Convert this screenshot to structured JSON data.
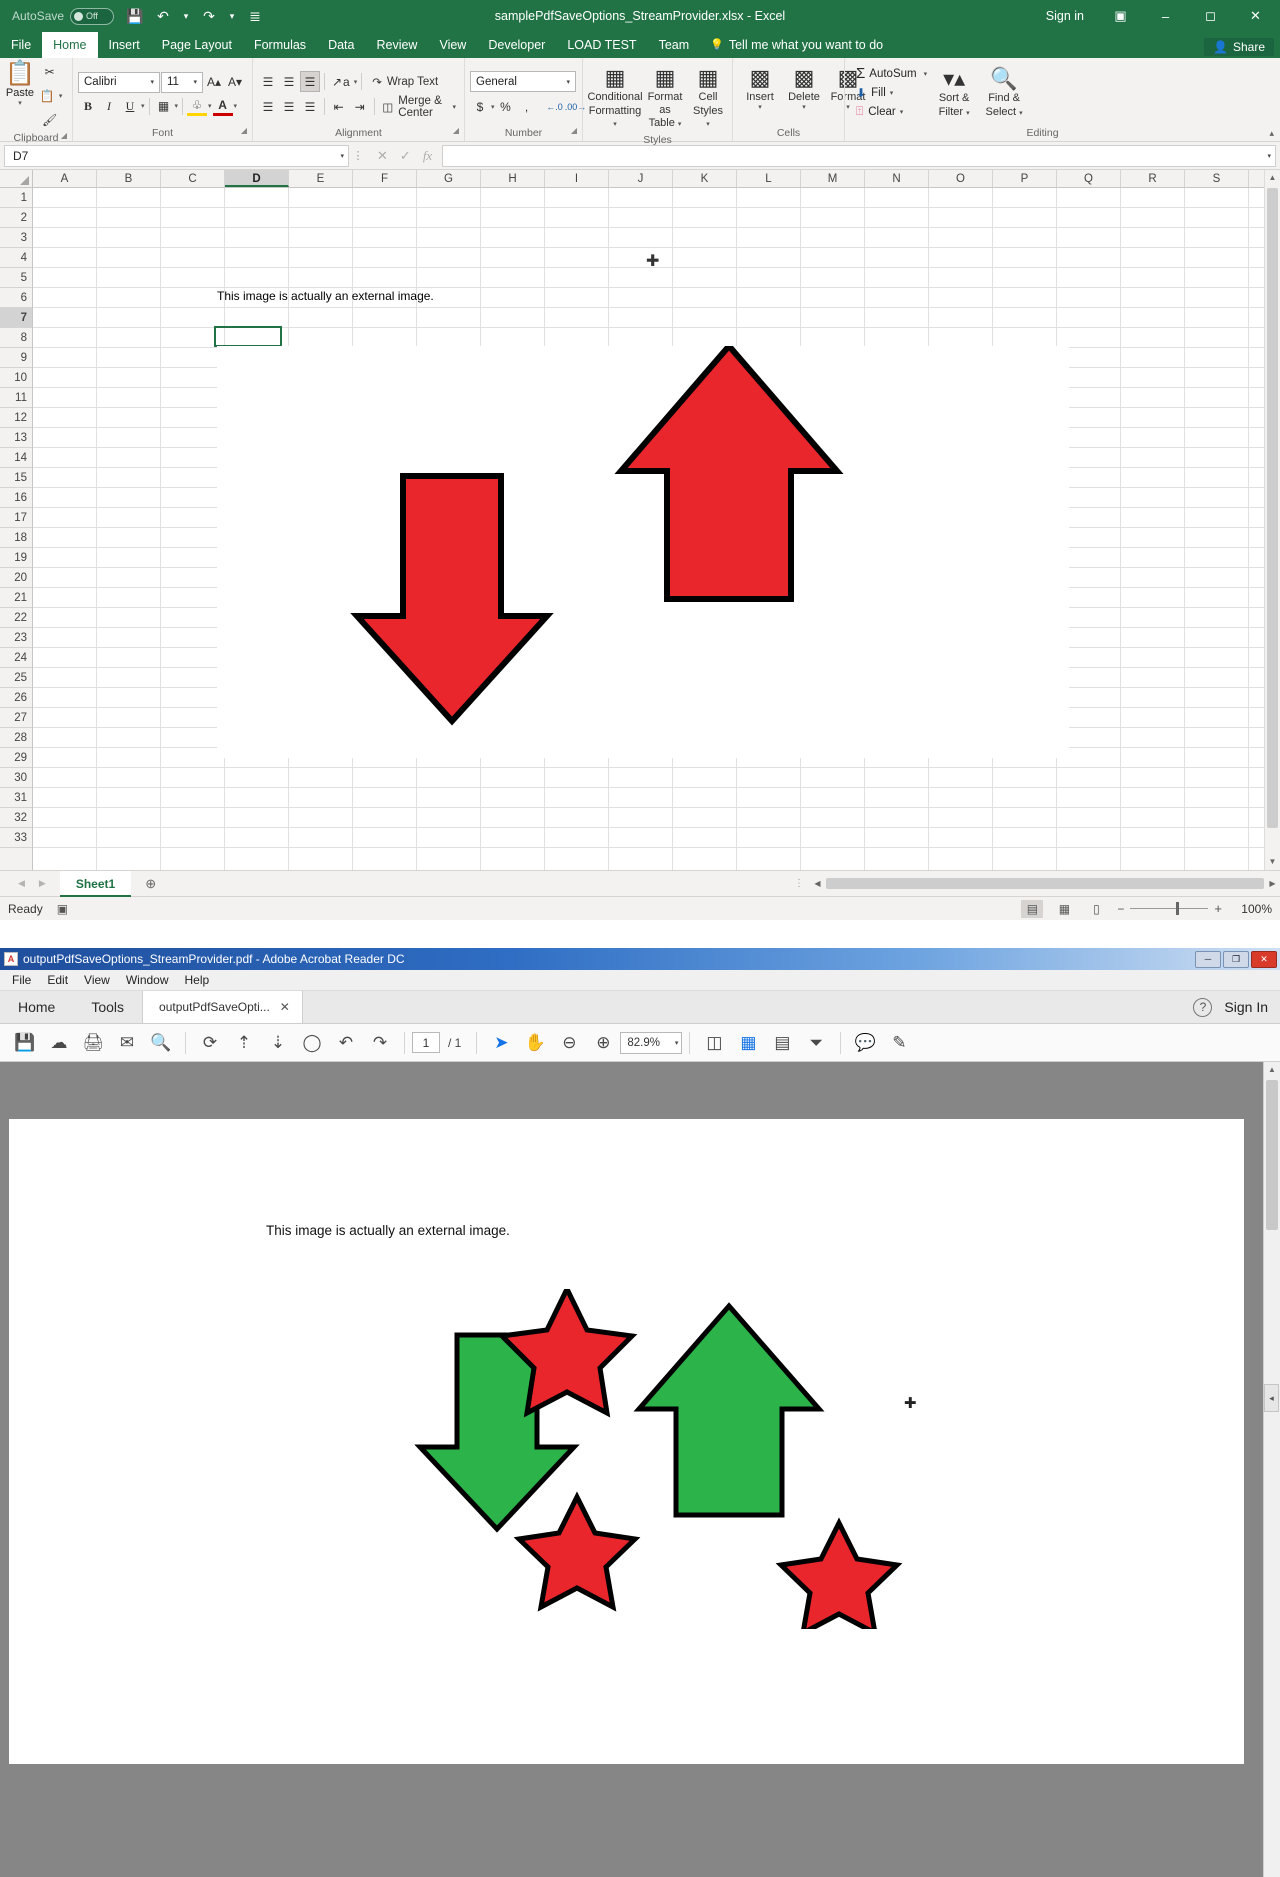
{
  "excel": {
    "titlebar": {
      "autosave_label": "AutoSave",
      "autosave_state": "Off",
      "save_icon": "save-icon",
      "undo_icon": "undo-icon",
      "redo_icon": "redo-icon",
      "customize_icon": "customize-qat-icon",
      "document_title": "samplePdfSaveOptions_StreamProvider.xlsx  -  Excel",
      "signin_label": "Sign in",
      "ribbon_display_icon": "ribbon-display-options-icon",
      "minimize_icon": "minimize-icon",
      "restore_icon": "restore-icon",
      "close_icon": "close-icon"
    },
    "tabs": [
      {
        "label": "File",
        "active": false
      },
      {
        "label": "Home",
        "active": true
      },
      {
        "label": "Insert",
        "active": false
      },
      {
        "label": "Page Layout",
        "active": false
      },
      {
        "label": "Formulas",
        "active": false
      },
      {
        "label": "Data",
        "active": false
      },
      {
        "label": "Review",
        "active": false
      },
      {
        "label": "View",
        "active": false
      },
      {
        "label": "Developer",
        "active": false
      },
      {
        "label": "LOAD TEST",
        "active": false
      },
      {
        "label": "Team",
        "active": false
      }
    ],
    "tellme_placeholder": "Tell me what you want to do",
    "share_label": "Share",
    "ribbon": {
      "clipboard": {
        "group_label": "Clipboard",
        "paste_label": "Paste",
        "cut_icon": "cut-scissors-icon",
        "copy_icon": "copy-icon",
        "format_painter_icon": "format-painter-icon"
      },
      "font": {
        "group_label": "Font",
        "font_name": "Calibri",
        "font_size": "11",
        "grow_font_icon": "grow-font-icon",
        "shrink_font_icon": "shrink-font-icon",
        "bold_label": "B",
        "italic_label": "I",
        "underline_label": "U",
        "borders_icon": "borders-icon",
        "fill_color_icon": "fill-color-icon",
        "font_color_icon": "font-color-icon"
      },
      "alignment": {
        "group_label": "Alignment",
        "top_align_icon": "align-top-icon",
        "middle_align_icon": "align-middle-icon",
        "bottom_align_icon": "align-bottom-icon",
        "orientation_icon": "text-orientation-icon",
        "align_left_icon": "align-left-icon",
        "align_center_icon": "align-center-icon",
        "align_right_icon": "align-right-icon",
        "decrease_indent_icon": "decrease-indent-icon",
        "increase_indent_icon": "increase-indent-icon",
        "wrap_text_label": "Wrap Text",
        "merge_center_label": "Merge & Center"
      },
      "number": {
        "group_label": "Number",
        "format": "General",
        "accounting_icon": "accounting-format-icon",
        "percent_label": "%",
        "comma_label": ",",
        "decrease_decimal_icon": "decrease-decimal-icon",
        "increase_decimal_icon": "increase-decimal-icon"
      },
      "styles": {
        "group_label": "Styles",
        "conditional_formatting_label": "Conditional\nFormatting",
        "conditional_line1": "Conditional",
        "conditional_line2": "Formatting",
        "format_table_line1": "Format as",
        "format_table_line2": "Table",
        "cell_styles_line1": "Cell",
        "cell_styles_line2": "Styles"
      },
      "cells": {
        "group_label": "Cells",
        "insert_label": "Insert",
        "delete_label": "Delete",
        "format_label": "Format"
      },
      "editing": {
        "group_label": "Editing",
        "autosum_label": "AutoSum",
        "fill_label": "Fill",
        "clear_label": "Clear",
        "sort_filter_line1": "Sort &",
        "sort_filter_line2": "Filter",
        "find_select_line1": "Find &",
        "find_select_line2": "Select"
      },
      "collapse_icon": "collapse-ribbon-icon"
    },
    "formula_bar": {
      "name_box_value": "D7",
      "cancel_icon": "cancel-icon",
      "enter_icon": "confirm-icon",
      "insert_function_icon": "insert-function-icon",
      "formula_value": ""
    },
    "grid": {
      "columns": [
        "A",
        "B",
        "C",
        "D",
        "E",
        "F",
        "G",
        "H",
        "I",
        "J",
        "K",
        "L",
        "M",
        "N",
        "O",
        "P",
        "Q",
        "R",
        "S"
      ],
      "selected_column": "D",
      "rows": [
        1,
        2,
        3,
        4,
        5,
        6,
        7,
        8,
        9,
        10,
        11,
        12,
        13,
        14,
        15,
        16,
        17,
        18,
        19,
        20,
        21,
        22,
        23,
        24,
        25,
        26,
        27,
        28,
        29,
        30,
        31,
        32,
        33
      ],
      "selected_row": 7,
      "cells": [
        {
          "ref": "D5",
          "value": "This image is actually an external image."
        }
      ],
      "picture": {
        "name": "embedded-arrows-image",
        "shapes": [
          {
            "name": "down-arrow-shape",
            "fill": "#E8262C",
            "stroke": "#000000"
          },
          {
            "name": "up-arrow-shape",
            "fill": "#E8262C",
            "stroke": "#000000"
          }
        ]
      },
      "mouse_cursor": "excel-plus-cursor"
    },
    "sheet_tabs": {
      "prev_icon": "prev-sheet-icon",
      "next_icon": "next-sheet-icon",
      "sheets": [
        "Sheet1"
      ],
      "active_sheet": "Sheet1",
      "new_sheet_icon": "new-sheet-icon"
    },
    "status_bar": {
      "status_text": "Ready",
      "macro_record_icon": "record-macro-icon",
      "normal_view_icon": "normal-view-icon",
      "page_layout_icon": "page-layout-view-icon",
      "page_break_icon": "page-break-preview-icon",
      "zoom_out_label": "−",
      "zoom_in_label": "+",
      "zoom_percent": "100%"
    }
  },
  "acrobat": {
    "titlebar": {
      "app_icon": "acrobat-icon",
      "title": "outputPdfSaveOptions_StreamProvider.pdf - Adobe Acrobat Reader DC",
      "minimize_icon": "minimize-icon",
      "restore_icon": "restore-icon",
      "close_icon": "close-icon"
    },
    "menu": [
      "File",
      "Edit",
      "View",
      "Window",
      "Help"
    ],
    "tabs": {
      "home_label": "Home",
      "tools_label": "Tools",
      "document_tab": "outputPdfSaveOpti...",
      "close_tab_icon": "close-tab-icon",
      "help_icon": "help-icon",
      "signin_label": "Sign In"
    },
    "toolbar": {
      "save_icon": "save-icon",
      "upload_icon": "cloud-upload-icon",
      "print_icon": "print-icon",
      "email_icon": "email-icon",
      "search_icon": "search-icon",
      "rotate_icon": "rotate-icon",
      "prev_page_icon": "previous-page-icon",
      "next_page_icon": "next-page-icon",
      "zoom_fit_icon": "fit-page-icon",
      "undo_icon": "undo-icon",
      "redo_icon": "redo-icon",
      "page_current": "1",
      "page_total": "/ 1",
      "select_tool_icon": "select-cursor-icon",
      "hand_tool_icon": "hand-tool-icon",
      "zoom_out_icon": "zoom-out-icon",
      "zoom_in_icon": "zoom-in-icon",
      "zoom_value": "82.9%",
      "fit_width_icon": "fit-width-icon",
      "fit_page_icon": "fit-page-icon",
      "zoom_selection_icon": "zoom-to-selection-icon",
      "scroll_mode_icon": "scroll-mode-icon",
      "comment_icon": "comment-icon",
      "highlight_icon": "highlight-icon"
    },
    "document": {
      "text": "This image is actually an external image.",
      "shapes": [
        {
          "name": "down-arrow-shape",
          "fill": "#2CB34A",
          "stroke": "#000000"
        },
        {
          "name": "up-arrow-shape",
          "fill": "#2CB34A",
          "stroke": "#000000"
        },
        {
          "name": "star-shape-top",
          "fill": "#E8262C",
          "stroke": "#000000"
        },
        {
          "name": "star-shape-bottom-left",
          "fill": "#E8262C",
          "stroke": "#000000"
        },
        {
          "name": "star-shape-bottom-right",
          "fill": "#E8262C",
          "stroke": "#000000"
        }
      ],
      "mouse_cursor": "pdf-crosshair-cursor"
    },
    "right_panel_handle_icon": "expand-right-panel-icon"
  },
  "colors": {
    "excel_green": "#217346",
    "acrobat_blue": "#2f6ec4",
    "red": "#E8262C",
    "green": "#2CB34A"
  }
}
